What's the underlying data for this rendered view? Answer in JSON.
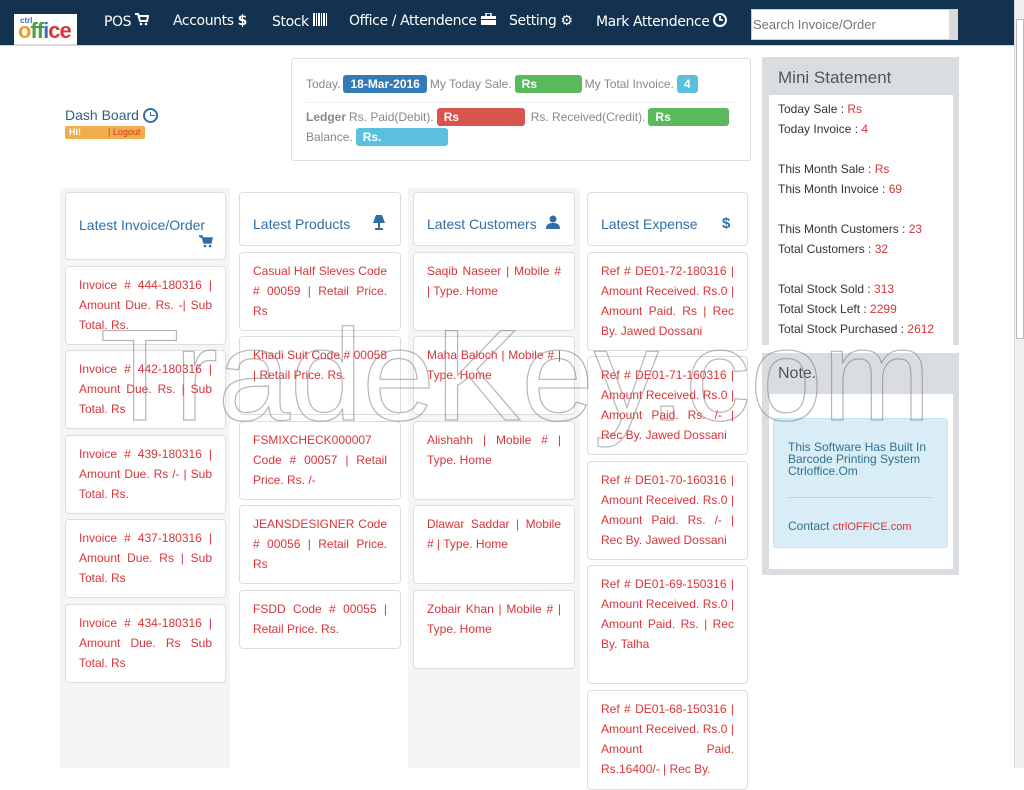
{
  "navbar": {
    "logo": {
      "small": "ctrl",
      "main": "office"
    },
    "items": [
      {
        "label": "POS",
        "icon": "shopping-cart-icon",
        "glyph": "🛒"
      },
      {
        "label": "Accounts",
        "icon": "dollar-icon",
        "glyph": "$"
      },
      {
        "label": "Stock",
        "icon": "barcode-icon",
        "glyph": "▥"
      },
      {
        "label": "Office / Attendence",
        "icon": "briefcase-icon",
        "glyph": "💼"
      },
      {
        "label": "Setting",
        "icon": "gear-icon",
        "glyph": "⚙"
      },
      {
        "label": "Mark Attendence",
        "icon": "clock-icon",
        "glyph": "🕒"
      }
    ],
    "search_placeholder": "Search Invoice/Order"
  },
  "dashboard": {
    "title": "Dash Board",
    "greeting": "Hi!",
    "logout": "| Logout"
  },
  "summary": {
    "today_label": "Today.",
    "today_date": "18-Mar-2016",
    "today_sale_label": "My Today Sale.",
    "today_sale_value": "Rs",
    "total_invoice_label": "My Total Invoice.",
    "total_invoice_value": "4",
    "ledger_label": "Ledger",
    "paid_label": "Rs. Paid(Debit).",
    "paid_value": "Rs",
    "received_label": "Rs. Received(Credit).",
    "received_value": "Rs",
    "balance_label": "Balance.",
    "balance_value": "Rs."
  },
  "panels": {
    "invoices": {
      "title": "Latest Invoice/Order",
      "items": [
        "Invoice # 444-180316 | Amount Due. Rs. -| Sub Total. Rs.",
        "Invoice # 442-180316 | Amount Due. Rs. | Sub Total. Rs",
        "Invoice # 439-180316 | Amount Due. Rs /- | Sub Total. Rs.",
        "Invoice # 437-180316 | Amount Due. Rs | Sub Total. Rs",
        "Invoice # 434-180316 | Amount Due. Rs Sub Total. Rs"
      ]
    },
    "products": {
      "title": "Latest Products",
      "items": [
        "Casual Half Sleves Code # 00059 | Retail Price. Rs",
        "Khadi Suit Code # 00058 | Retail Price. Rs.",
        "FSMIXCHECK000007 Code # 00057 | Retail Price. Rs. /-",
        "JEANSDESIGNER Code # 00056 | Retail Price. Rs",
        "FSDD Code # 00055 | Retail Price. Rs."
      ]
    },
    "customers": {
      "title": "Latest Customers",
      "items": [
        "Saqib Naseer | Mobile # | Type. Home",
        "Maha Baloch | Mobile # | Type. Home",
        "Alishahh | Mobile # | Type. Home",
        "Dlawar Saddar | Mobile # | Type. Home",
        "Zobair Khan | Mobile # | Type. Home"
      ]
    },
    "expenses": {
      "title": "Latest Expense",
      "items": [
        "Ref # DE01-72-180316 | Amount Received. Rs.0 | Amount Paid. Rs | Rec By. Jawed Dossani",
        "Ref # DE01-71-160316 | Amount Received. Rs.0 | Amount Paid. Rs. /- | Rec By. Jawed Dossani",
        "Ref # DE01-70-160316 | Amount Received. Rs.0 | Amount Paid. Rs. /- | Rec By. Jawed Dossani",
        "Ref # DE01-69-150316 | Amount Received. Rs.0 | Amount Paid. Rs. | Rec By. Talha",
        "Ref # DE01-68-150316 | Amount Received. Rs.0 | Amount Paid. Rs.16400/- | Rec By."
      ]
    }
  },
  "mini_statement": {
    "title": "Mini Statement",
    "groups": [
      [
        {
          "label": "Today Sale : ",
          "value": "Rs"
        },
        {
          "label": "Today Invoice : ",
          "value": " 4"
        }
      ],
      [
        {
          "label": "This Month Sale : ",
          "value": "Rs"
        },
        {
          "label": "This Month Invoice : ",
          "value": "69"
        }
      ],
      [
        {
          "label": "This Month Customers : ",
          "value": "23"
        },
        {
          "label": "Total Customers : ",
          "value": "32"
        }
      ],
      [
        {
          "label": "Total Stock Sold : ",
          "value": "313"
        },
        {
          "label": "Total Stock Left : ",
          "value": "2299"
        },
        {
          "label": "Total Stock Purchased : ",
          "value": "2612"
        }
      ]
    ]
  },
  "note": {
    "title": "Note.",
    "message": "This Software Has Built In Barcode Printing System Ctrloffice.Om",
    "contact_label": "Contact ",
    "contact_link": "ctrlOFFICE.com"
  },
  "watermark": "TradeKey.com"
}
